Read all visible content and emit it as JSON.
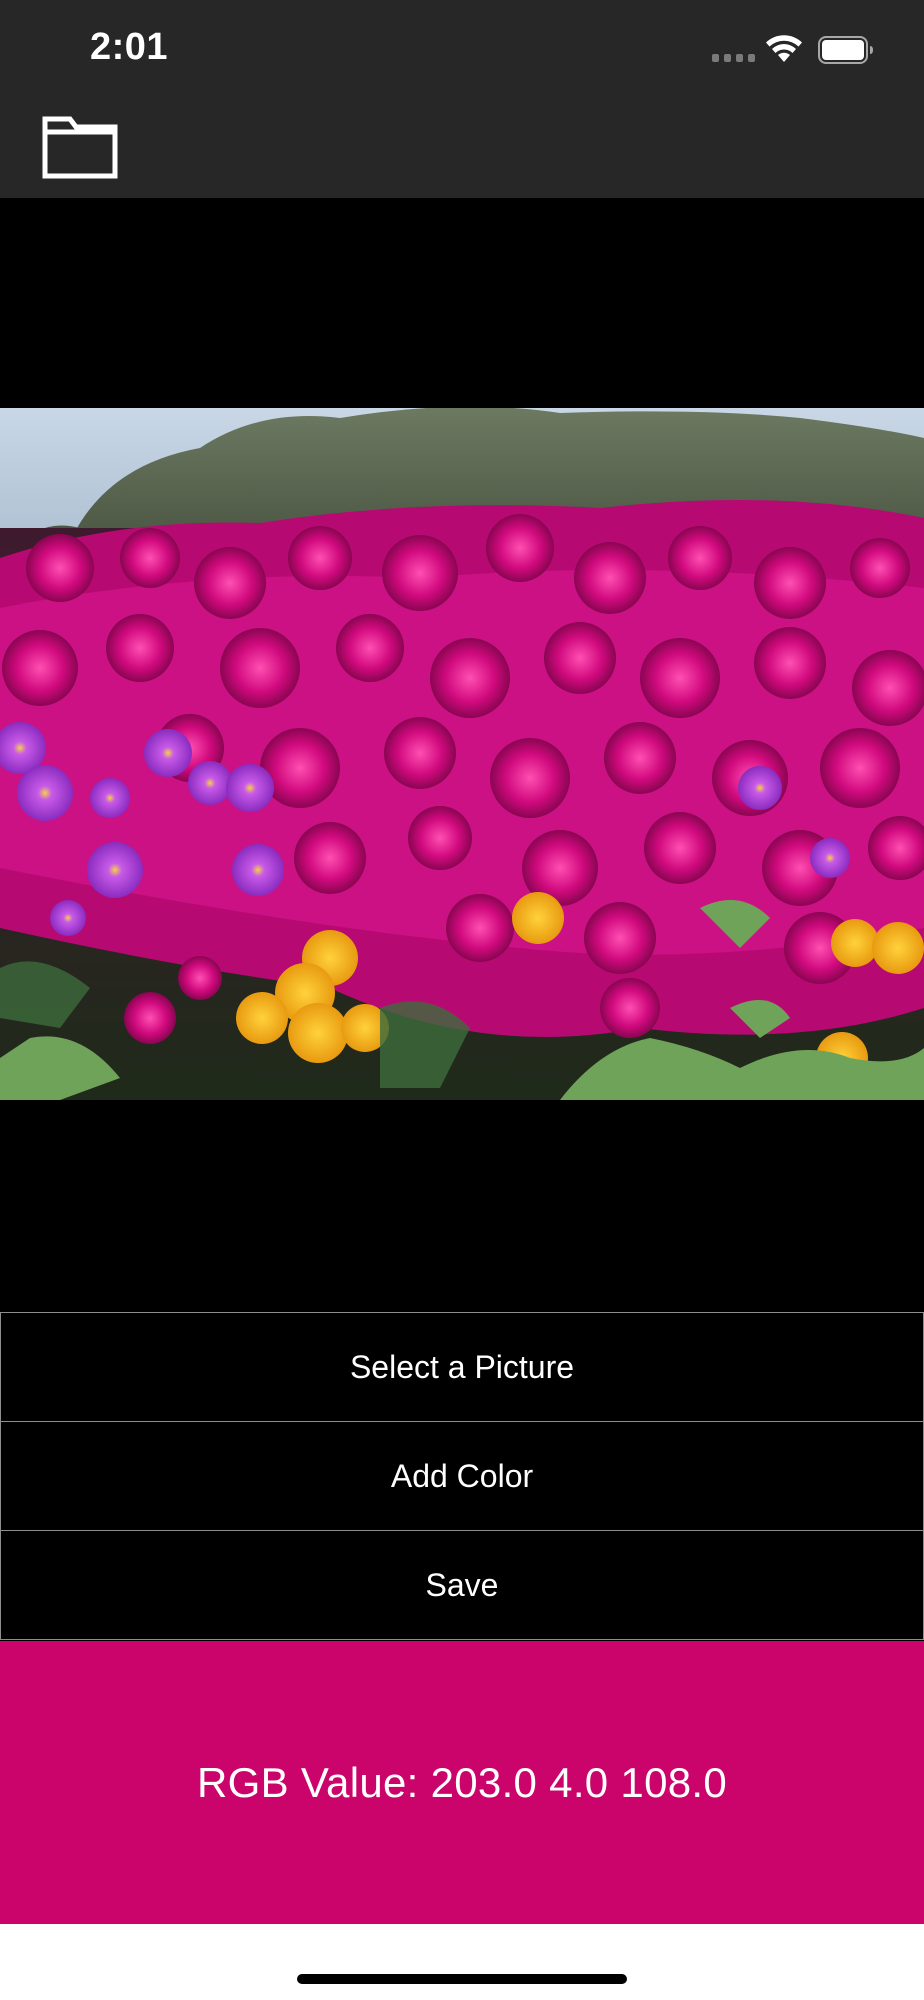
{
  "status_bar": {
    "time": "2:01",
    "icons": [
      "signal-icon",
      "wifi-icon",
      "battery-icon"
    ]
  },
  "nav_bar": {
    "icon": "folder-icon"
  },
  "image": {
    "description_icon": "photo"
  },
  "buttons": {
    "select_label": "Select a Picture",
    "add_color_label": "Add Color",
    "save_label": "Save"
  },
  "color_panel": {
    "rgb_text": "RGB Value: 203.0 4.0 108.0",
    "background_color": "#CB046C"
  },
  "colors": {
    "bar_background": "#272727",
    "button_border": "#8E8E8E",
    "accent": "#CB046C"
  }
}
